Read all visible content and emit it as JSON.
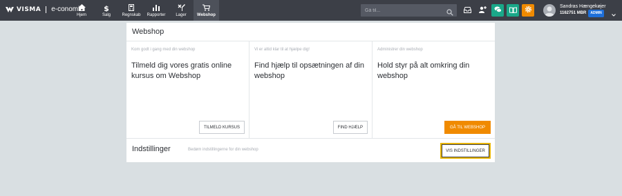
{
  "brand": {
    "mark": "VISMA",
    "name": "e-conomic"
  },
  "nav": [
    {
      "label": "Hjem",
      "icon": "home-icon"
    },
    {
      "label": "Salg",
      "icon": "dollar-icon"
    },
    {
      "label": "Regnskab",
      "icon": "calculator-icon"
    },
    {
      "label": "Rapporter",
      "icon": "bar-chart-icon"
    },
    {
      "label": "Lager",
      "icon": "inventory-icon"
    },
    {
      "label": "Webshop",
      "icon": "cart-icon",
      "active": true
    }
  ],
  "search": {
    "placeholder": "Gå til..."
  },
  "toolbar": {
    "buttons": [
      {
        "icon": "inbox-icon",
        "color": "#3c3f47"
      },
      {
        "icon": "add-user-icon",
        "color": "#3c3f47"
      },
      {
        "icon": "chat-icon",
        "color": "#1aa889"
      },
      {
        "icon": "book-icon",
        "color": "#1aa889"
      },
      {
        "icon": "gear-icon",
        "color": "#f08a00"
      }
    ]
  },
  "user": {
    "name": "Sandras Hængekøjer",
    "account": "1162751 MBR",
    "role": "ADMIN"
  },
  "page": {
    "title": "Webshop",
    "tiles": [
      {
        "intro": "Kom godt i gang med din webshop",
        "heading": "Tilmeld dig vores gratis online kursus om Webshop",
        "button": "TILMELD KURSUS"
      },
      {
        "intro": "Vi er altid klar til at hjælpe dig!",
        "heading": "Find hjælp til opsætningen af din webshop",
        "button": "FIND HJÆLP"
      },
      {
        "intro": "Administrer din webshop",
        "heading": "Hold styr på alt omkring din webshop",
        "button": "GÅ TIL WEBSHOP"
      }
    ],
    "settings": {
      "title": "Indstillinger",
      "description": "Bedøm indstillingerne for din webshop",
      "button": "VIS INDSTILLINGER"
    }
  },
  "colors": {
    "accent": "#f08a00",
    "teal": "#1aa889",
    "topbar": "#3c3f47",
    "focus": "#e8b400"
  }
}
